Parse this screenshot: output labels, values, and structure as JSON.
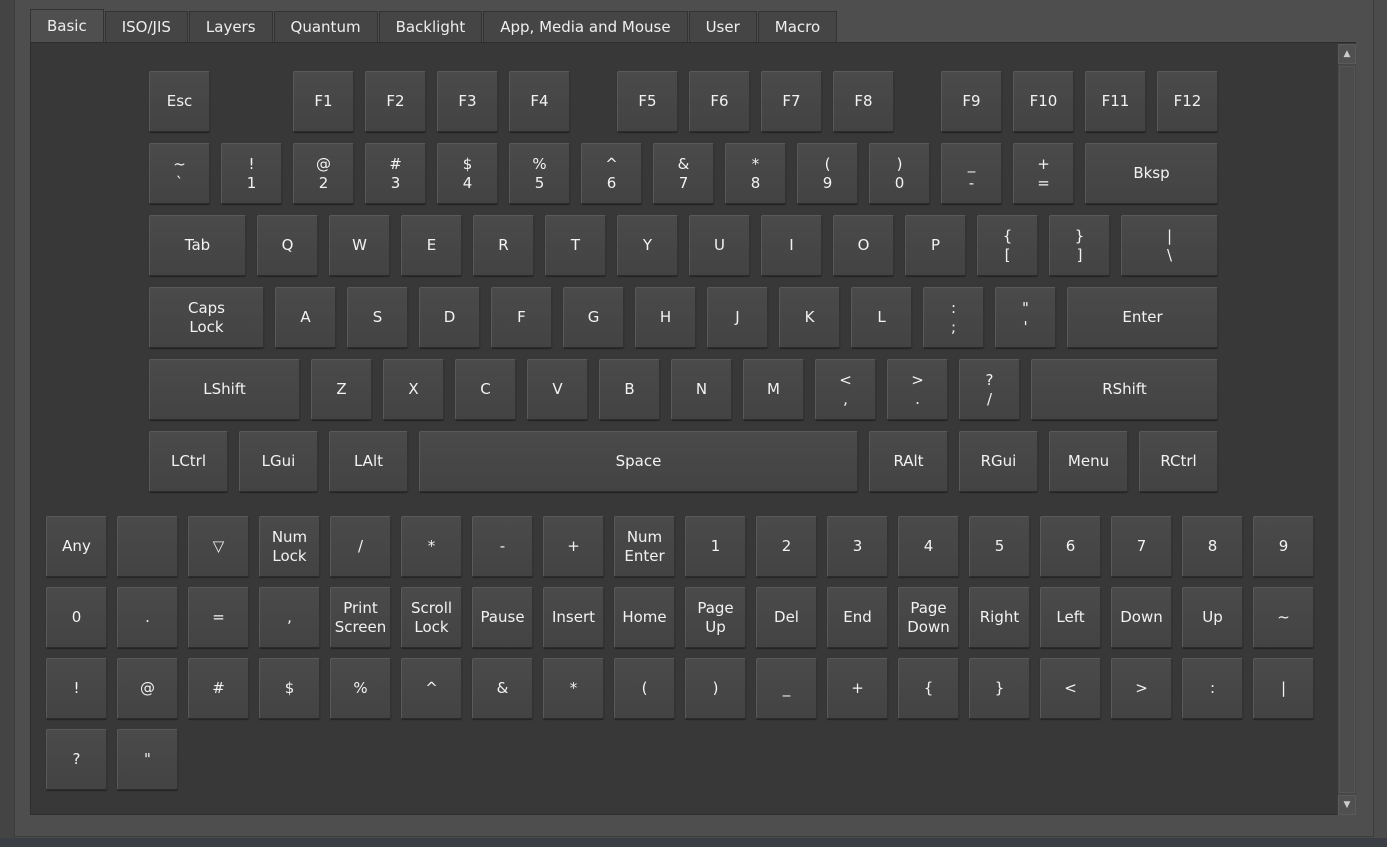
{
  "tabs": [
    "Basic",
    "ISO/JIS",
    "Layers",
    "Quantum",
    "Backlight",
    "App, Media and Mouse",
    "User",
    "Macro"
  ],
  "active_tab": "Basic",
  "scrollbar": {
    "up_icon": "triangle-up-icon",
    "down_icon": "triangle-down-icon"
  },
  "keyboard": {
    "rows": [
      [
        "Esc",
        "F1",
        "F2",
        "F3",
        "F4",
        "F5",
        "F6",
        "F7",
        "F8",
        "F9",
        "F10",
        "F11",
        "F12"
      ],
      [
        "~\n`",
        "!\n1",
        "@\n2",
        "#\n3",
        "$\n4",
        "%\n5",
        "^\n6",
        "&\n7",
        "*\n8",
        "(\n9",
        ")\n0",
        "_\n-",
        "+\n=",
        "Bksp"
      ],
      [
        "Tab",
        "Q",
        "W",
        "E",
        "R",
        "T",
        "Y",
        "U",
        "I",
        "O",
        "P",
        "{\n[",
        "}\n]",
        "|\n\\"
      ],
      [
        "Caps\nLock",
        "A",
        "S",
        "D",
        "F",
        "G",
        "H",
        "J",
        "K",
        "L",
        ":\n;",
        "\"\n'",
        "Enter"
      ],
      [
        "LShift",
        "Z",
        "X",
        "C",
        "V",
        "B",
        "N",
        "M",
        "<\n,",
        ">\n.",
        "?\n/",
        "RShift"
      ],
      [
        "LCtrl",
        "LGui",
        "LAlt",
        "Space",
        "RAlt",
        "RGui",
        "Menu",
        "RCtrl"
      ]
    ]
  },
  "extra_keys": [
    "Any",
    "",
    "▽",
    "Num\nLock",
    "/",
    "*",
    "-",
    "+",
    "Num\nEnter",
    "1",
    "2",
    "3",
    "4",
    "5",
    "6",
    "7",
    "8",
    "9",
    "0",
    ".",
    "=",
    ",",
    "Print\nScreen",
    "Scroll\nLock",
    "Pause",
    "Insert",
    "Home",
    "Page\nUp",
    "Del",
    "End",
    "Page\nDown",
    "Right",
    "Left",
    "Down",
    "Up",
    "~",
    "!",
    "@",
    "#",
    "$",
    "%",
    "^",
    "&",
    "*",
    "(",
    ")",
    "_",
    "+",
    "{",
    "}",
    "<",
    ">",
    ":",
    "|",
    "?",
    "\""
  ]
}
